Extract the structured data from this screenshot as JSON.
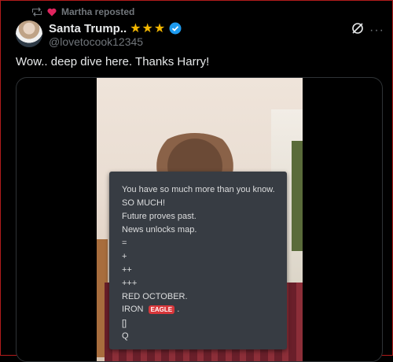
{
  "repost": {
    "text": "Martha reposted"
  },
  "author": {
    "name": "Santa Trump..",
    "stars": "★★★",
    "handle": "@lovetocook12345"
  },
  "tweet": {
    "text": "Wow.. deep dive here. Thanks Harry!"
  },
  "overlay": {
    "lines": [
      "You have so much more than you know.",
      "SO MUCH!",
      "Future proves past.",
      "News unlocks map.",
      "=",
      "+",
      "++",
      "+++",
      "RED OCTOBER.",
      "IRON",
      "[]",
      "Q"
    ],
    "badge": "EAGLE",
    "iron_suffix": "."
  },
  "colors": {
    "accent_star": "#f2b600",
    "badge_red": "#d8373b",
    "verified_blue": "#1d9bf0"
  },
  "icons": [
    "repost-icon",
    "heart-icon",
    "verified-badge-icon",
    "grok-icon",
    "more-icon"
  ]
}
